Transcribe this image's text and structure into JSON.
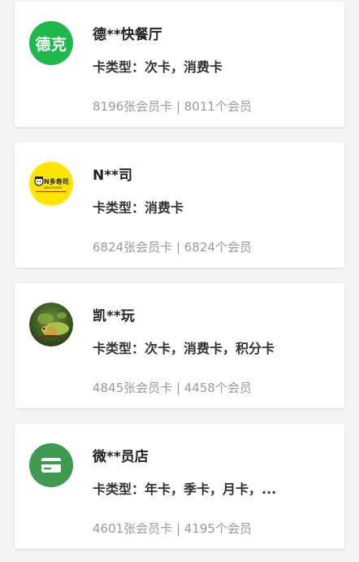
{
  "merchants": [
    {
      "avatar": {
        "type": "text",
        "text": "德克",
        "color": "#1fb84a"
      },
      "name": "德**快餐厅",
      "card_types": "卡类型：次卡，消费卡",
      "stats": "8196张会员卡 | 8011个会员"
    },
    {
      "avatar": {
        "type": "logo",
        "text": "N多寿司",
        "subtext": "NDUOSUSHI",
        "color": "#ffe500"
      },
      "name": "N**司",
      "card_types": "卡类型：消费卡",
      "stats": "6824张会员卡 | 6824个会员"
    },
    {
      "avatar": {
        "type": "photo",
        "icon": "chameleon-photo"
      },
      "name": "凯**玩",
      "card_types": "卡类型：次卡，消费卡，积分卡",
      "stats": "4845张会员卡 | 4458个会员"
    },
    {
      "avatar": {
        "type": "icon",
        "icon": "card-icon",
        "color": "#3d9a4f"
      },
      "name": "微**员店",
      "card_types": "卡类型：年卡，季卡，月卡，...",
      "stats": "4601张会员卡 | 4195个会员"
    }
  ]
}
